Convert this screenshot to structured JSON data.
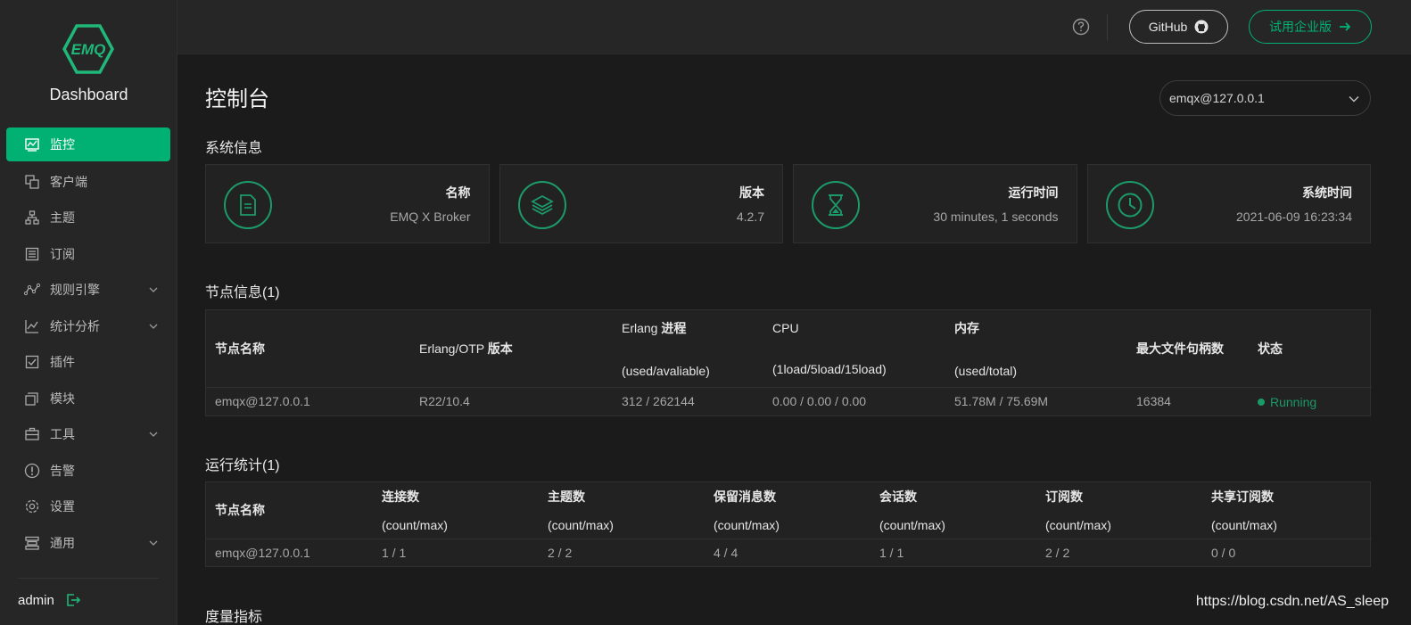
{
  "sidebar": {
    "logo_text": "EMQ",
    "brand": "Dashboard",
    "items": [
      {
        "label": "监控",
        "icon": "monitor-icon",
        "active": true
      },
      {
        "label": "客户端",
        "icon": "clients-icon"
      },
      {
        "label": "主题",
        "icon": "topics-icon"
      },
      {
        "label": "订阅",
        "icon": "subscriptions-icon"
      },
      {
        "label": "规则引擎",
        "icon": "rule-engine-icon",
        "expandable": true
      },
      {
        "label": "统计分析",
        "icon": "analytics-icon",
        "expandable": true
      },
      {
        "label": "插件",
        "icon": "plugins-icon"
      },
      {
        "label": "模块",
        "icon": "modules-icon"
      },
      {
        "label": "工具",
        "icon": "tools-icon",
        "expandable": true
      },
      {
        "label": "告警",
        "icon": "alarm-icon"
      },
      {
        "label": "设置",
        "icon": "settings-icon"
      },
      {
        "label": "通用",
        "icon": "general-icon",
        "expandable": true
      }
    ],
    "user": "admin"
  },
  "header": {
    "github_label": "GitHub",
    "trial_label": "试用企业版"
  },
  "main": {
    "title": "控制台",
    "node_select": "emqx@127.0.0.1",
    "system_info_title": "系统信息",
    "cards": [
      {
        "label": "名称",
        "value": "EMQ X Broker",
        "icon": "document-icon"
      },
      {
        "label": "版本",
        "value": "4.2.7",
        "icon": "layers-icon"
      },
      {
        "label": "运行时间",
        "value": "30 minutes, 1 seconds",
        "icon": "hourglass-icon"
      },
      {
        "label": "系统时间",
        "value": "2021-06-09 16:23:34",
        "icon": "clock-icon"
      }
    ],
    "node_info": {
      "title": "节点信息(1)",
      "headers": {
        "name": "节点名称",
        "otp_a": "Erlang/OTP ",
        "otp_b": "版本",
        "proc_a": "Erlang ",
        "proc_b": "进程",
        "proc_sub": "(used/avaliable)",
        "cpu": "CPU",
        "cpu_sub": "(1load/5load/15load)",
        "mem": "内存",
        "mem_sub": "(used/total)",
        "max_fds": "最大文件句柄数",
        "status": "状态"
      },
      "rows": [
        {
          "name": "emqx@127.0.0.1",
          "otp": "R22/10.4",
          "proc": "312 / 262144",
          "cpu": "0.00 / 0.00 / 0.00",
          "mem": "51.78M / 75.69M",
          "max_fds": "16384",
          "status": "Running"
        }
      ]
    },
    "run_stats": {
      "title": "运行统计(1)",
      "headers": [
        {
          "label": "节点名称",
          "sub": ""
        },
        {
          "label": "连接数",
          "sub": "(count/max)"
        },
        {
          "label": "主题数",
          "sub": "(count/max)"
        },
        {
          "label": "保留消息数",
          "sub": "(count/max)"
        },
        {
          "label": "会话数",
          "sub": "(count/max)"
        },
        {
          "label": "订阅数",
          "sub": "(count/max)"
        },
        {
          "label": "共享订阅数",
          "sub": "(count/max)"
        }
      ],
      "rows": [
        [
          "emqx@127.0.0.1",
          "1 / 1",
          "2 / 2",
          "4 / 4",
          "1 / 1",
          "2 / 2",
          "0 / 0"
        ]
      ]
    },
    "metrics_title": "度量指标"
  },
  "watermark": "https://blog.csdn.net/AS_sleep",
  "colors": {
    "accent": "#00b173",
    "background": "#1b1b1b",
    "panel": "#262626"
  }
}
